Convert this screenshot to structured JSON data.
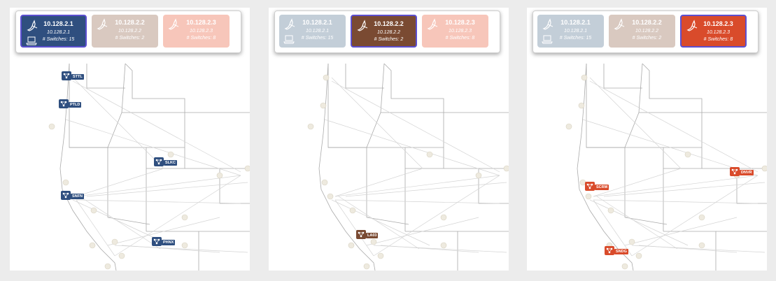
{
  "controllers": [
    {
      "ip": "10.128.2.1",
      "switches": "# Switches: 15"
    },
    {
      "ip": "10.128.2.2",
      "switches": "# Switches: 2"
    },
    {
      "ip": "10.128.2.3",
      "switches": "# Switches: 8"
    }
  ],
  "colors": {
    "c1": "#2f4f7f",
    "c1_faded": "#c3ced8",
    "c2": "#7a4a32",
    "c2_faded": "#d9c9c0",
    "c3": "#d94b2b",
    "c3_faded": "#f7c6ba",
    "active_border": "#5c4fd0"
  },
  "panels": [
    {
      "active_index": 0,
      "nodes": [
        {
          "label": "STTL"
        },
        {
          "label": "PTLD"
        },
        {
          "label": "SLKC"
        },
        {
          "label": "SNFN"
        },
        {
          "label": "PHNX"
        }
      ]
    },
    {
      "active_index": 1,
      "nodes": [
        {
          "label": "LA03"
        }
      ]
    },
    {
      "active_index": 2,
      "nodes": [
        {
          "label": "DNVR"
        },
        {
          "label": "SCRM"
        },
        {
          "label": "SNDG"
        }
      ]
    }
  ]
}
